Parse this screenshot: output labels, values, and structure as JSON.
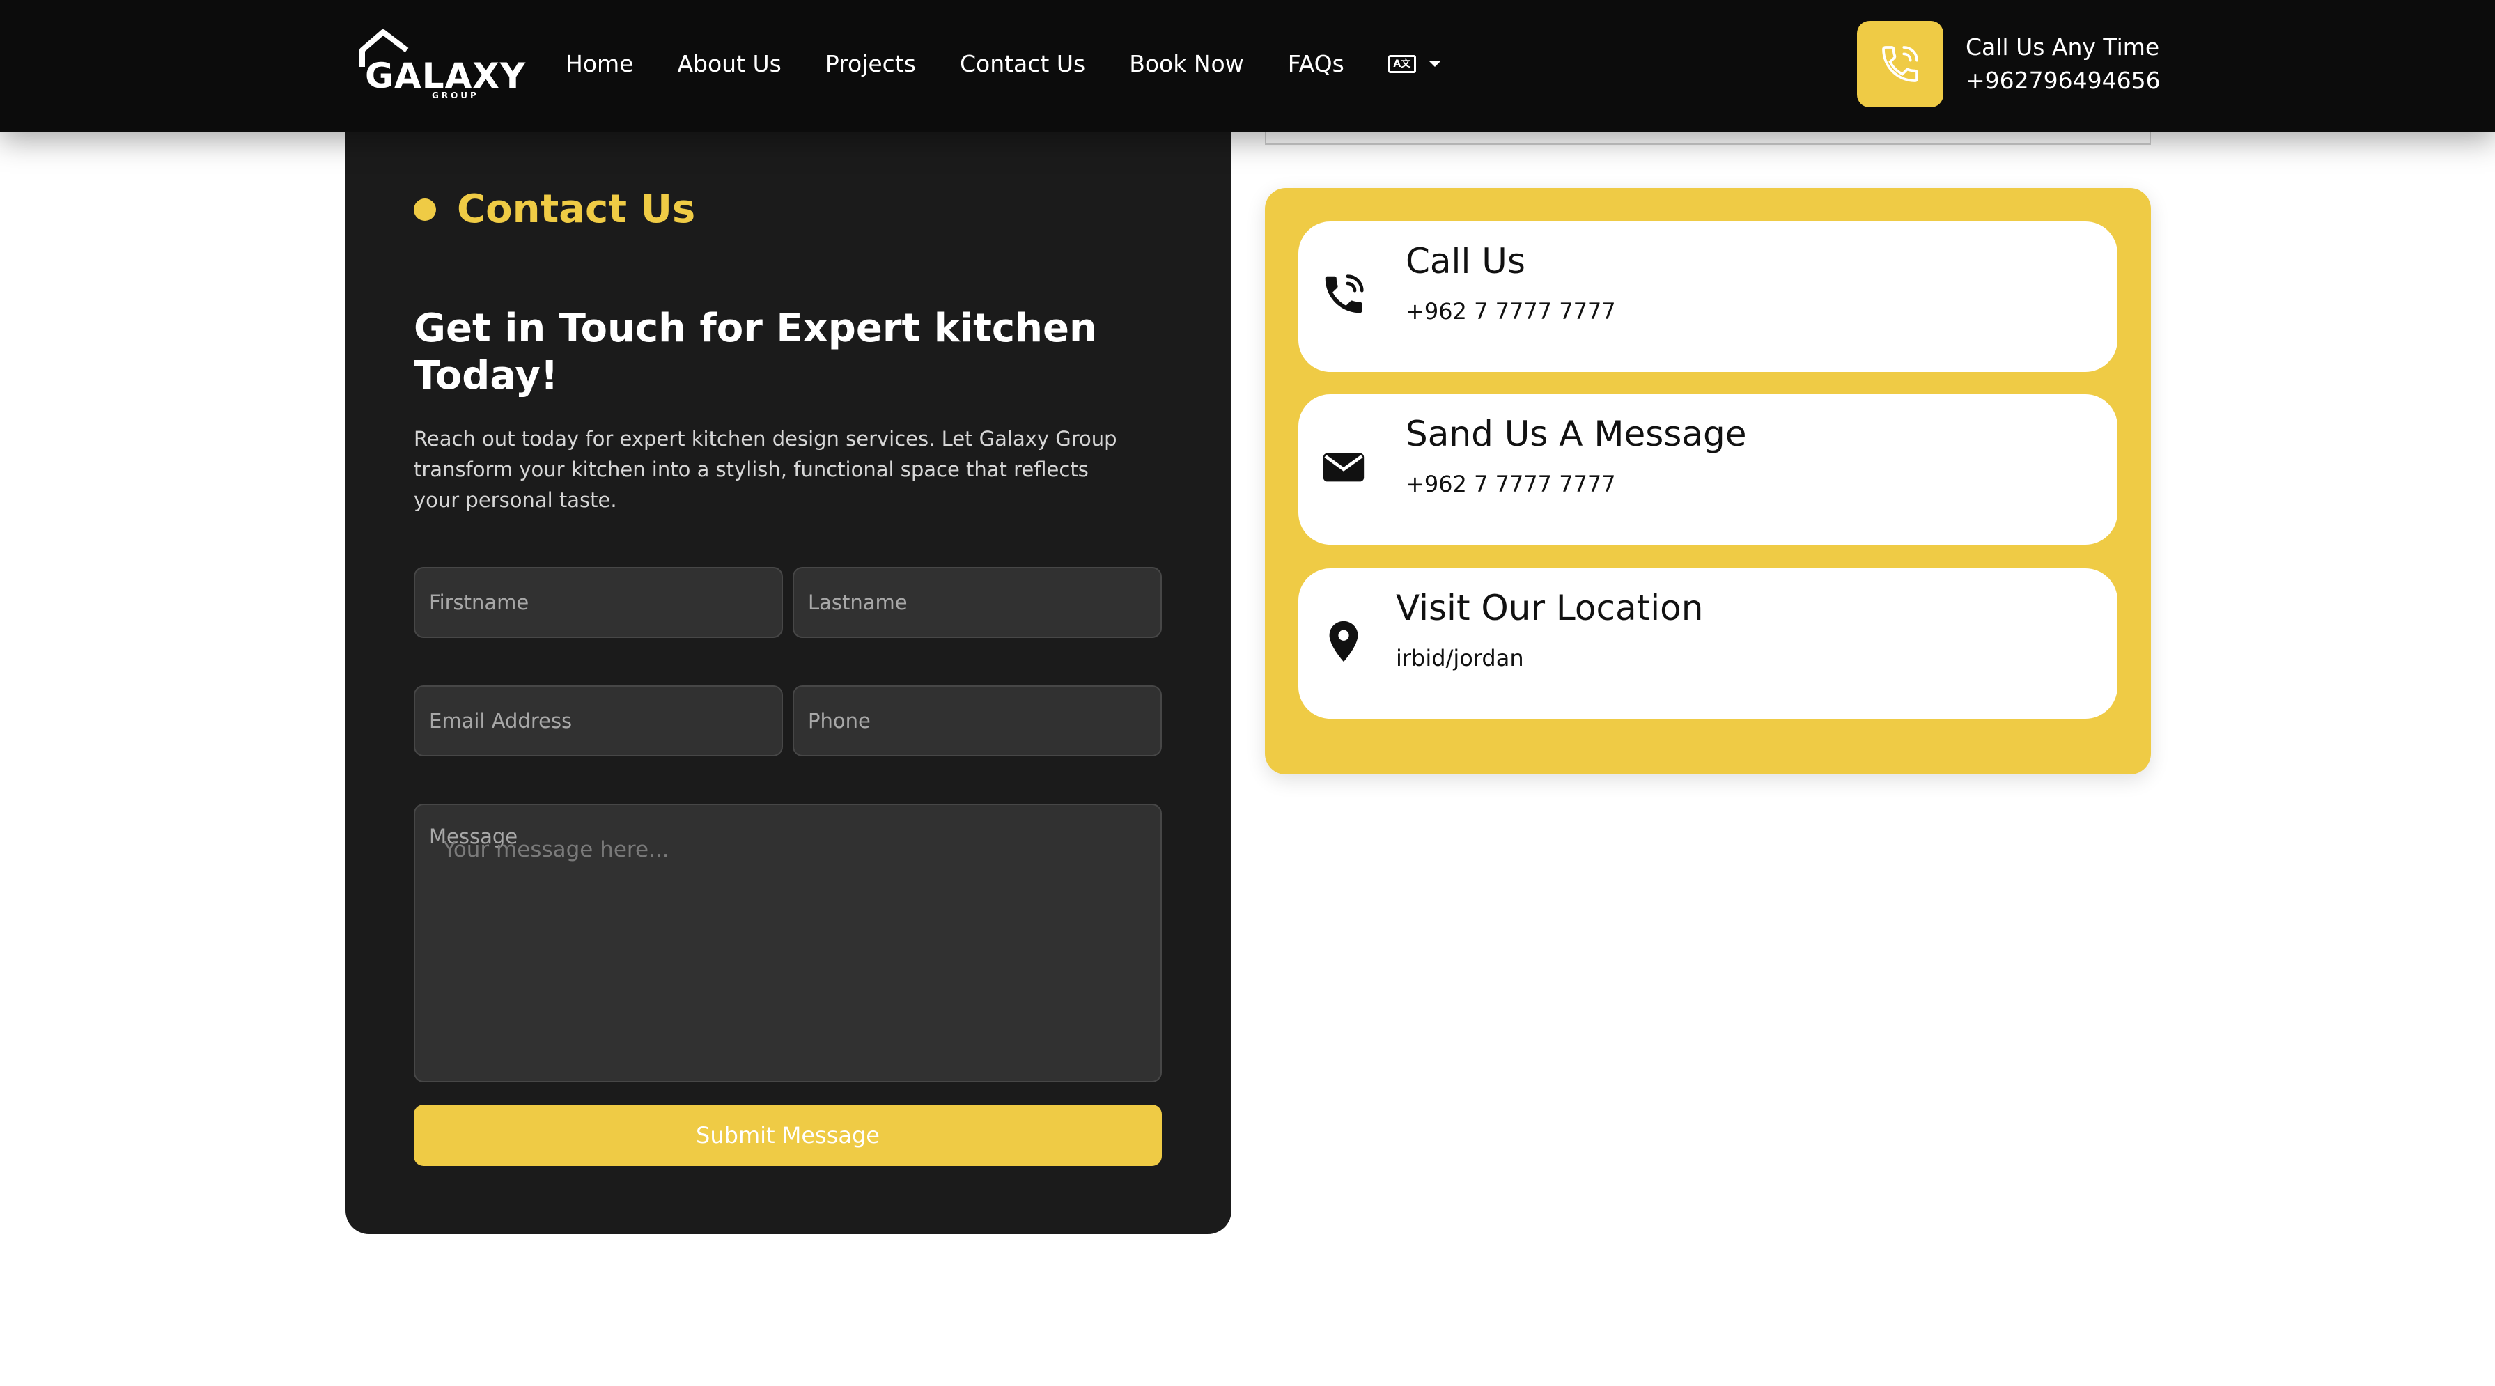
{
  "brand": {
    "name": "GALAXY",
    "sub": "GROUP"
  },
  "nav": {
    "items": [
      "Home",
      "About Us",
      "Projects",
      "Contact Us",
      "Book Now",
      "FAQs"
    ],
    "lang_icon": "translate-icon"
  },
  "header_call": {
    "line1": "Call Us Any Time",
    "line2": "+962796494656"
  },
  "contact": {
    "tag": "Contact Us",
    "headline_bold": "Get in Touch",
    "headline_rest": " for Expert kitchen Today!",
    "lead": "Reach out today for expert kitchen design services. Let Galaxy Group transform your kitchen into a stylish, functional space that reflects your personal taste.",
    "fields": {
      "firstname": "Firstname",
      "lastname": "Lastname",
      "email": "Email Address",
      "phone": "Phone",
      "message_label": "Message",
      "message_placeholder": "Your message here..."
    },
    "submit": "Submit Message"
  },
  "info": [
    {
      "title": "Call Us",
      "detail": "+962 7 7777 7777",
      "icon": "phone-icon"
    },
    {
      "title": "Sand Us A Message",
      "detail": "+962 7 7777 7777",
      "icon": "envelope-icon"
    },
    {
      "title": "Visit Our Location",
      "detail": "irbid/jordan",
      "icon": "location-pin-icon"
    }
  ],
  "colors": {
    "accent": "#efcb45",
    "dark": "#1b1b1b",
    "header": "#0c0c0c"
  }
}
